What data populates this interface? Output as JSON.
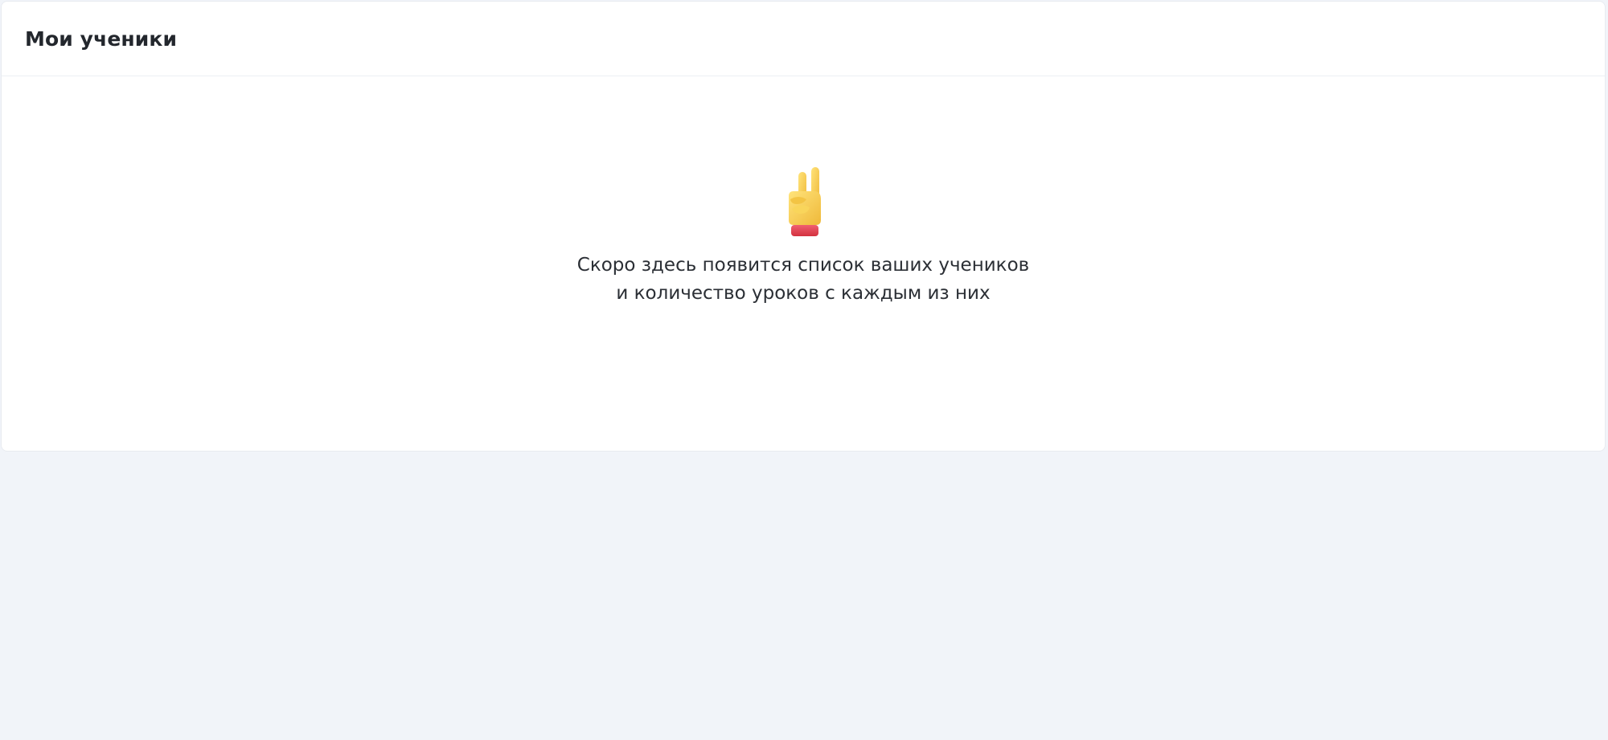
{
  "header": {
    "title": "Мои ученики"
  },
  "empty_state": {
    "icon": "victory-hand-icon",
    "line1": "Скоро здесь появится список ваших учеников",
    "line2": "и количество уроков с каждым из них"
  },
  "colors": {
    "page_background": "#f1f4f9",
    "card_background": "#ffffff",
    "title_text": "#23272d",
    "body_text": "#2b2f35",
    "hand_yellow": "#f7cf48",
    "cuff_red": "#e0414f"
  }
}
